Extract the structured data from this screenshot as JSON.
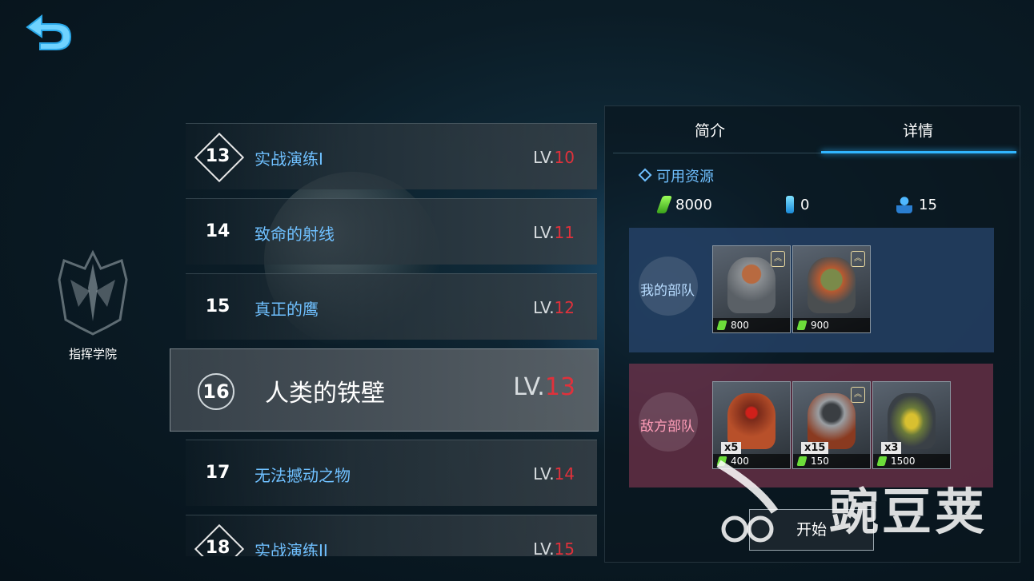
{
  "academy": {
    "label": "指挥学院"
  },
  "missions": [
    {
      "num": "13",
      "name": "实战演练I",
      "lv_prefix": "LV.",
      "lv": "10"
    },
    {
      "num": "14",
      "name": "致命的射线",
      "lv_prefix": "LV.",
      "lv": "11"
    },
    {
      "num": "15",
      "name": "真正的鹰",
      "lv_prefix": "LV.",
      "lv": "12"
    },
    {
      "num": "16",
      "name": "人类的铁壁",
      "lv_prefix": "LV.",
      "lv": "13"
    },
    {
      "num": "17",
      "name": "无法撼动之物",
      "lv_prefix": "LV.",
      "lv": "14"
    },
    {
      "num": "18",
      "name": "实战演练II",
      "lv_prefix": "LV.",
      "lv": "15"
    }
  ],
  "panel": {
    "tabs": [
      "简介",
      "详情"
    ],
    "resources": {
      "title": "可用资源",
      "crystal": "8000",
      "energy": "0",
      "population": "15"
    },
    "my_army": {
      "label": "我的部队",
      "units": [
        {
          "cost": "800"
        },
        {
          "cost": "900"
        }
      ]
    },
    "enemy_army": {
      "label": "敌方部队",
      "units": [
        {
          "count": "x5",
          "cost": "400"
        },
        {
          "count": "x15",
          "cost": "150"
        },
        {
          "count": "x3",
          "cost": "1500"
        }
      ]
    },
    "start_label": "开始"
  },
  "watermark": "豌豆荚",
  "colors": {
    "accent": "#31b6ff",
    "link": "#6fc0ff",
    "level_red": "#e0313b"
  }
}
